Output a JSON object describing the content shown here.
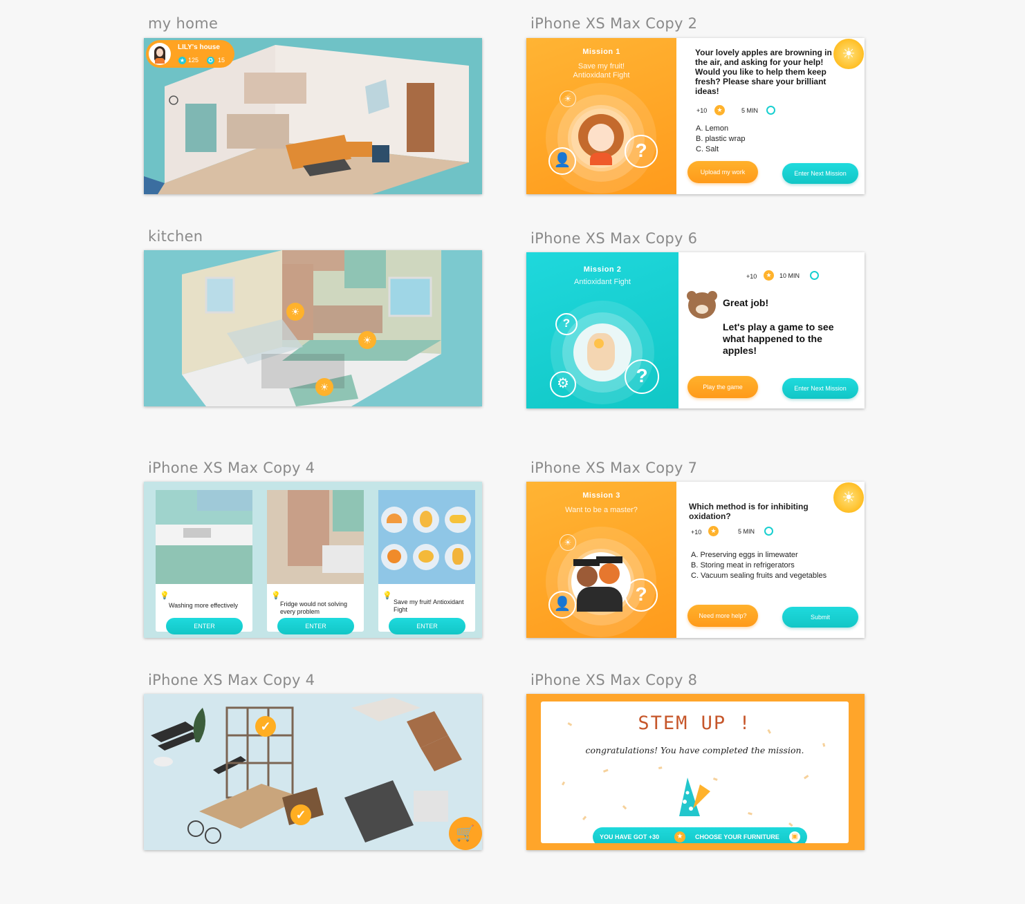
{
  "artboards": {
    "a1": "my home",
    "a2": "iPhone XS Max Copy 2",
    "a3": "kitchen",
    "a4": "iPhone XS Max Copy 6",
    "a5": "iPhone XS Max Copy 4",
    "a6": "iPhone XS Max Copy 7",
    "a7": "iPhone XS Max Copy 4",
    "a8": "iPhone XS Max Copy 8"
  },
  "home": {
    "badge_name": "LILY's house",
    "stars": "125",
    "medals": "15"
  },
  "m1": {
    "title": "Mission 1",
    "sub1": "Save my fruit!",
    "sub2": "Antioxidant Fight",
    "question": "Your lovely apples are browning in the air, and asking for your help! Would you like to help them keep fresh? Please share your brilliant ideas!",
    "points": "+10",
    "time": "5 MIN",
    "options": [
      "A. Lemon",
      "B. plastic wrap",
      "C. Salt"
    ],
    "btn_left": "Upload my work",
    "btn_right": "Enter Next Mission"
  },
  "m2": {
    "title": "Mission 2",
    "sub": "Antioxidant Fight",
    "points": "+10",
    "time": "10 MIN",
    "line1": "Great job!",
    "line2": "Let's play a game to see what happened to the apples!",
    "btn_left": "Play the game",
    "btn_right": "Enter Next Mission"
  },
  "select": {
    "cards": [
      {
        "label": "Washing more effectively",
        "btn": "ENTER"
      },
      {
        "label": "Fridge would not solving every problem",
        "btn": "ENTER"
      },
      {
        "label": "Save my fruit! Antioxidant Fight",
        "btn": "ENTER"
      }
    ]
  },
  "m3": {
    "title": "Mission 3",
    "sub": "Want to be a master?",
    "question": "Which method is for inhibiting oxidation?",
    "points": "+10",
    "time": "5 MIN",
    "options": [
      "A. Preserving eggs in limewater",
      "B. Storing meat in refrigerators",
      "C. Vacuum sealing fruits and vegetables"
    ],
    "btn_left": "Need more help?",
    "btn_right": "Submit"
  },
  "congrats": {
    "heading": "STEM UP !",
    "message": "congratulations! You have completed the mission.",
    "reward": "YOU HAVE GOT +30",
    "choose": "CHOOSE YOUR FURNITURE"
  },
  "colors": {
    "orange": "#ff9f1f",
    "teal": "#15cbcb",
    "sky": "#7cc9cf"
  }
}
